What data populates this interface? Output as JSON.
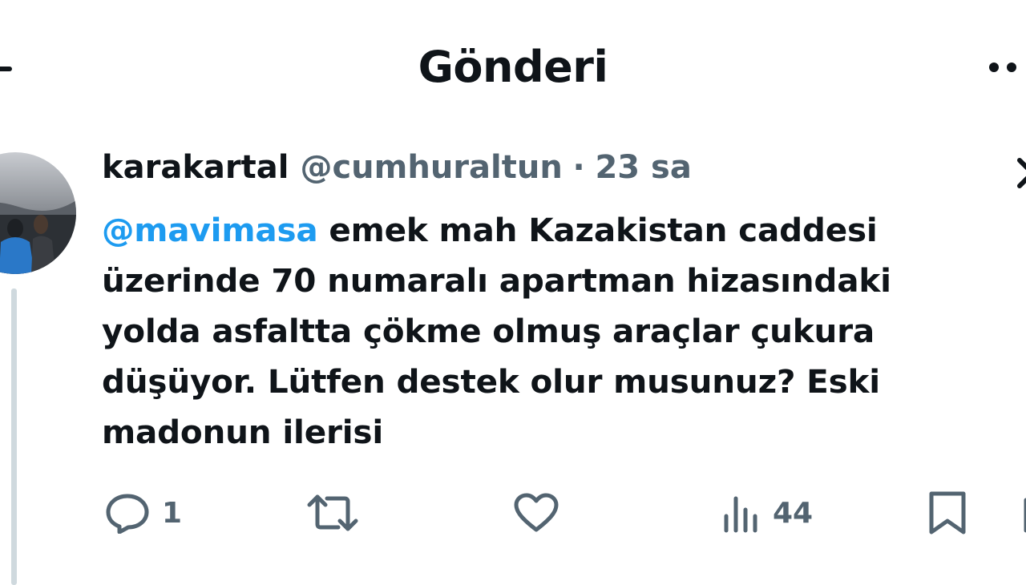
{
  "header": {
    "title": "Gönderi",
    "back_icon": "arrow-left-icon",
    "more_icon": "more-horizontal-icon"
  },
  "post": {
    "author_name": "karakartal",
    "handle": "@cumhuraltun",
    "separator": "·",
    "time": "23 sa",
    "mention": "@mavimasa",
    "lines": [
      " emek mah Kazakistan caddesi",
      "üzerinde 70 numaralı apartman hizasındaki",
      "yolda asfaltta çökme olmuş araçlar çukura",
      "düşüyor. Lütfen destek olur musunuz? Eski",
      "madonun ilerisi"
    ]
  },
  "actions": {
    "reply": {
      "icon": "reply-icon",
      "count": "1"
    },
    "repost": {
      "icon": "repost-icon"
    },
    "like": {
      "icon": "heart-icon"
    },
    "views": {
      "icon": "views-icon",
      "count": "44"
    },
    "bookmark": {
      "icon": "bookmark-icon"
    }
  },
  "colors": {
    "text": "#0f1419",
    "secondary": "#536471",
    "link": "#1d9bf0",
    "divider": "#cfd9de"
  }
}
